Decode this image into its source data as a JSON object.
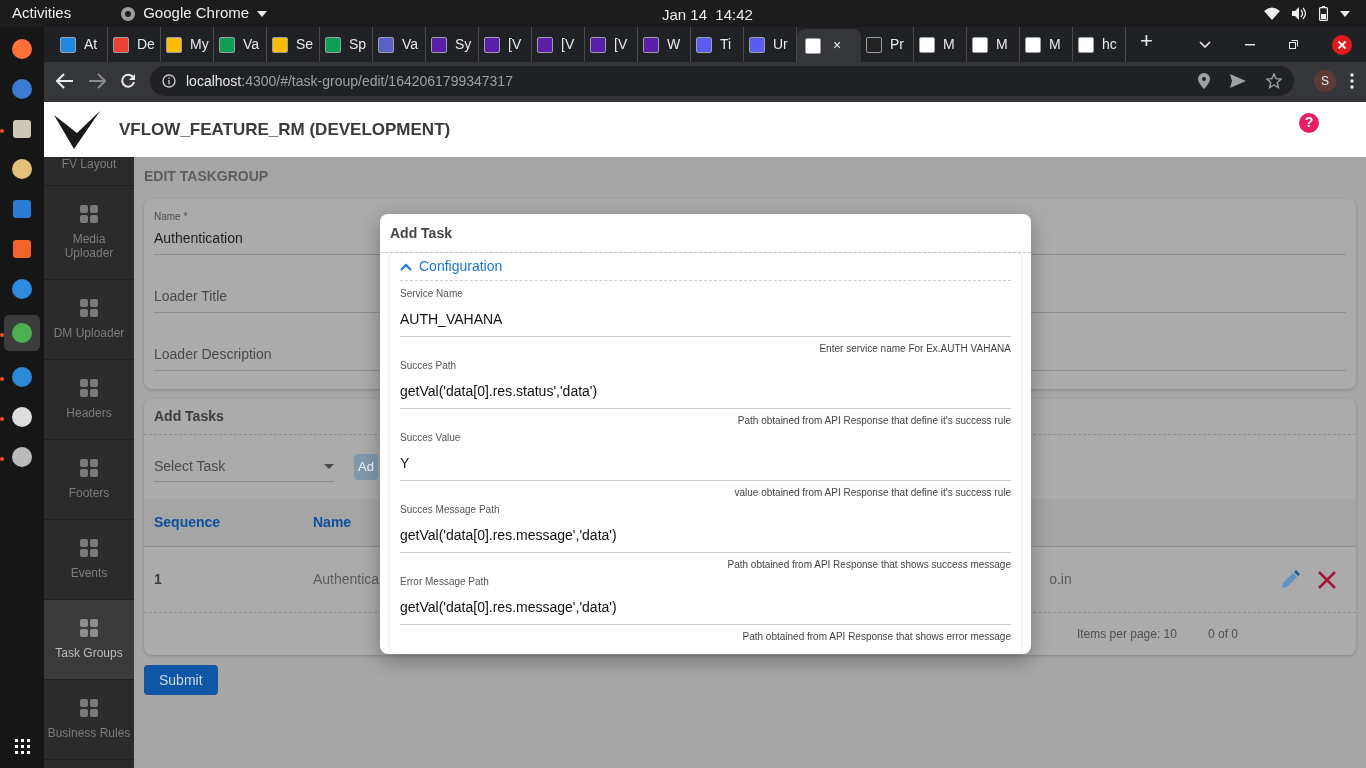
{
  "system_bar": {
    "activities": "Activities",
    "app": "Google Chrome",
    "clock": "Jan 14  14:42"
  },
  "dock": [
    {
      "kind": "firefox",
      "running": false
    },
    {
      "kind": "mail",
      "running": false
    },
    {
      "kind": "files",
      "running": true
    },
    {
      "kind": "music",
      "running": false
    },
    {
      "kind": "writer",
      "running": false
    },
    {
      "kind": "store",
      "running": false
    },
    {
      "kind": "help",
      "running": false
    },
    {
      "kind": "chrome",
      "running": true
    },
    {
      "kind": "code",
      "running": true
    },
    {
      "kind": "updater",
      "running": true
    },
    {
      "kind": "settings",
      "running": true
    }
  ],
  "browser": {
    "tabs": [
      {
        "label": "At",
        "color": "#1e88e5",
        "selected": false
      },
      {
        "label": "De",
        "color": "#ea4335",
        "selected": false
      },
      {
        "label": "My",
        "color": "#fbbc04",
        "selected": false
      },
      {
        "label": "Va",
        "color": "#0f9d58",
        "selected": false
      },
      {
        "label": "Se",
        "color": "#fbbc04",
        "selected": false
      },
      {
        "label": "Sp",
        "color": "#0f9d58",
        "selected": false
      },
      {
        "label": "Va",
        "color": "#5b5fc7",
        "selected": false
      },
      {
        "label": "Sy",
        "color": "#5a1fa8",
        "selected": false
      },
      {
        "label": "[V",
        "color": "#5a1fa8",
        "selected": false
      },
      {
        "label": "[V",
        "color": "#5a1fa8",
        "selected": false
      },
      {
        "label": "[V",
        "color": "#5a1fa8",
        "selected": false
      },
      {
        "label": "W",
        "color": "#5a1fa8",
        "selected": false
      },
      {
        "label": "Ti",
        "color": "#5b5bf0",
        "selected": false
      },
      {
        "label": "Ur",
        "color": "#5b5bf0",
        "selected": false
      },
      {
        "label": "×",
        "color": "#ffffff",
        "selected": true
      },
      {
        "label": "Pr",
        "color": "#222222",
        "selected": false
      },
      {
        "label": "M",
        "color": "#ffffff",
        "selected": false
      },
      {
        "label": "M",
        "color": "#ffffff",
        "selected": false
      },
      {
        "label": "M",
        "color": "#ffffff",
        "selected": false
      },
      {
        "label": "hc",
        "color": "#ffffff",
        "selected": false
      }
    ],
    "new_tab": "+",
    "address_host": "localhost",
    "address_rest": ":4300/#/task-group/edit/1642061799347317",
    "profile": "S"
  },
  "app": {
    "title": "VFLOW_FEATURE_RM (DEVELOPMENT)",
    "help": "?"
  },
  "sidebar": {
    "items": [
      {
        "label": "FV Layout",
        "selected": false
      },
      {
        "label": "Media Uploader",
        "selected": false
      },
      {
        "label": "DM Uploader",
        "selected": false
      },
      {
        "label": "Headers",
        "selected": false
      },
      {
        "label": "Footers",
        "selected": false
      },
      {
        "label": "Events",
        "selected": false
      },
      {
        "label": "Task Groups",
        "selected": true
      },
      {
        "label": "Business Rules",
        "selected": false
      }
    ]
  },
  "page": {
    "heading": "EDIT TASKGROUP",
    "fields": [
      {
        "label": "Name *",
        "value": "Authentication"
      },
      {
        "placeholder": "Loader Title"
      },
      {
        "placeholder": "Loader Description"
      }
    ],
    "tasks": {
      "title": "Add Tasks",
      "select_placeholder": "Select Task",
      "add_button": "Ad",
      "columns": [
        "Sequence",
        "Name"
      ],
      "rows": [
        {
          "sequence": "1",
          "name": "Authentica",
          "column_3": "o.in"
        }
      ],
      "items_per_page": "Items per page: 10",
      "range": "0 of 0"
    },
    "submit": "Submit"
  },
  "modal": {
    "title": "Add Task",
    "section": {
      "title": "Configuration",
      "expanded": true,
      "fields": [
        {
          "label": "Service Name",
          "value": "AUTH_VAHANA",
          "hint": "Enter service name For Ex.AUTH VAHANA"
        },
        {
          "label": "Succes Path",
          "value": "getVal('data[0].res.status','data')",
          "hint": "Path obtained from API Response that define it's success rule"
        },
        {
          "label": "Succes Value",
          "value": "Y",
          "hint": "value obtained from API Response that define it's success rule"
        },
        {
          "label": "Succes Message Path",
          "value": "getVal('data[0].res.message','data')",
          "hint": "Path obtained from API Response that shows success message"
        },
        {
          "label": "Error Message Path",
          "value": "getVal('data[0].res.message','data')",
          "hint": "Path obtained from API Response that shows error message"
        }
      ]
    }
  }
}
